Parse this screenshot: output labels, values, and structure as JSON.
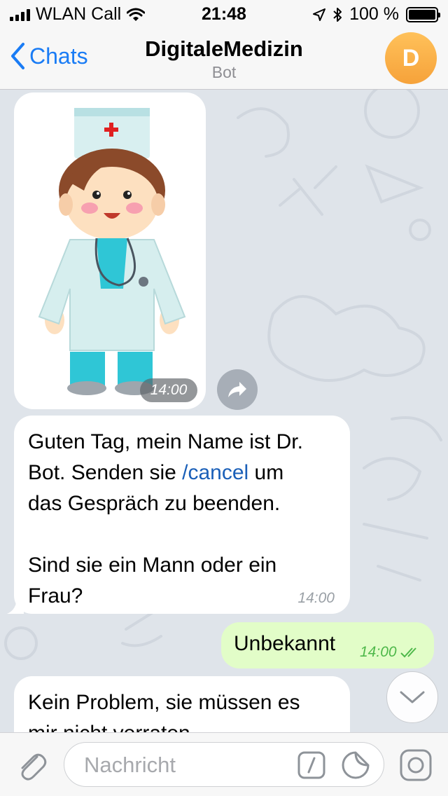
{
  "status_bar": {
    "carrier": "WLAN Call",
    "time": "21:48",
    "battery": "100 %",
    "icons": [
      "signal-icon",
      "wifi-icon",
      "location-icon",
      "bluetooth-icon",
      "battery-icon"
    ]
  },
  "nav": {
    "back_label": "Chats",
    "title": "DigitaleMedizin",
    "subtitle": "Bot",
    "avatar_letter": "D",
    "avatar_color": "#f6a23a"
  },
  "messages": [
    {
      "type": "photo",
      "direction": "incoming",
      "time": "14:00"
    },
    {
      "type": "text",
      "direction": "incoming",
      "line1": "Guten Tag, mein Name ist Dr.",
      "line2_before": "Bot.  Senden sie ",
      "link": "/cancel",
      "line2_after": " um",
      "line3": "das Gespräch zu beenden.",
      "line4": "Sind sie ein Mann oder ein",
      "line5": "Frau?",
      "time": "14:00"
    },
    {
      "type": "text",
      "direction": "outgoing",
      "text": "Unbekannt",
      "time": "14:00",
      "status": "read"
    },
    {
      "type": "text",
      "direction": "incoming",
      "line1": "Kein Problem, sie müssen es",
      "line2": "mir nicht verraten."
    }
  ],
  "input": {
    "placeholder": "Nachricht",
    "value": ""
  },
  "colors": {
    "accent": "#1a7cf5",
    "outgoing_bubble": "#e2fdc8",
    "read_check": "#4eb84a",
    "chat_background": "#dfe4ea"
  }
}
